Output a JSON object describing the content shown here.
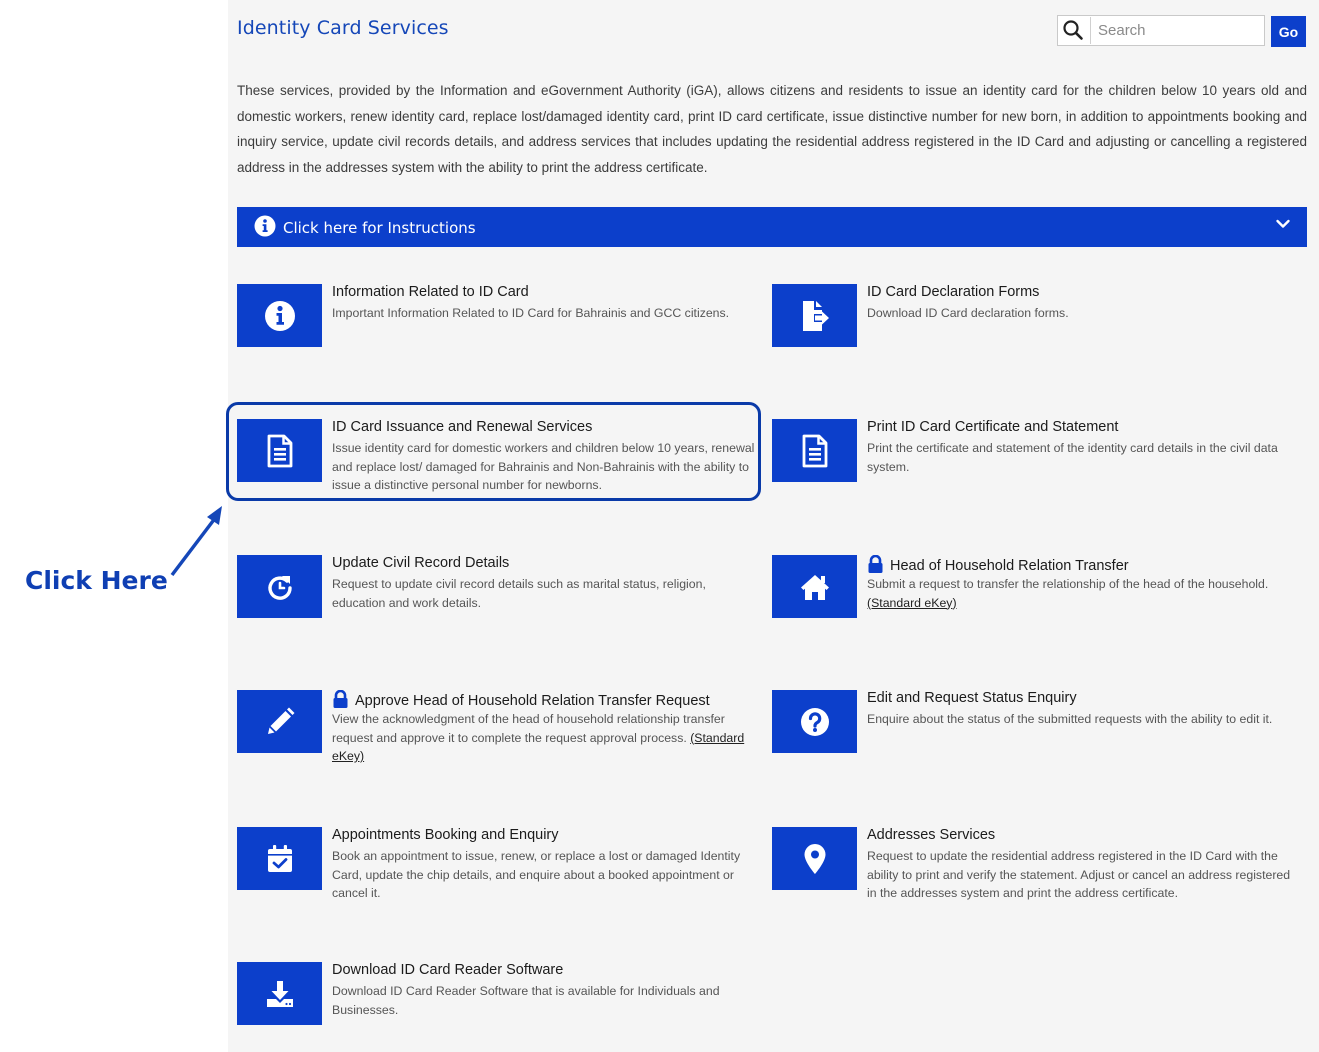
{
  "header": {
    "title": "Identity Card Services",
    "search_placeholder": "Search",
    "go_label": "Go"
  },
  "intro": "These services, provided by the Information and eGovernment Authority (iGA), allows citizens and residents to issue an identity card for the children below 10 years old and domestic workers, renew identity card, replace lost/damaged identity card, print ID card certificate, issue distinctive number for new born, in addition to appointments booking and inquiry service, update civil records details, and address services that includes updating the residential address registered in the ID Card and adjusting or cancelling a registered address in the addresses system with the ability to print the address certificate.",
  "instructions": {
    "label": "Click here for Instructions"
  },
  "services": [
    {
      "title": "Information Related to ID Card",
      "desc": "Important Information Related to ID Card for Bahrainis and GCC citizens.",
      "icon": "info-icon"
    },
    {
      "title": "ID Card Declaration Forms",
      "desc": "Download ID Card declaration forms.",
      "icon": "file-export-icon"
    },
    {
      "title": "ID Card Issuance and Renewal Services",
      "desc": "Issue identity card for domestic workers and children below 10 years, renewal and replace lost/ damaged for Bahrainis and Non-Bahrainis with the ability to issue a distinctive personal number for newborns.",
      "icon": "document-icon"
    },
    {
      "title": "Print ID Card Certificate and Statement",
      "desc": "Print the certificate and statement of the identity card details in the civil data system.",
      "icon": "document-icon"
    },
    {
      "title": "Update Civil Record Details",
      "desc": "Request to update civil record details such as marital status, religion, education and work details.",
      "icon": "refresh-icon"
    },
    {
      "title": "Head of Household Relation Transfer",
      "desc": "Submit a request to transfer the relationship of the head of the household.",
      "link": "(Standard eKey)",
      "icon": "home-icon",
      "locked": true
    },
    {
      "title": "Approve Head of Household Relation Transfer Request",
      "desc": "View the acknowledgment of the head of household relationship transfer request and approve it to complete the request approval process.",
      "link": "(Standard eKey)",
      "icon": "pencil-icon",
      "locked": true
    },
    {
      "title": "Edit and Request Status Enquiry",
      "desc": "Enquire about the status of the submitted requests with the ability to edit it.",
      "icon": "question-icon"
    },
    {
      "title": "Appointments Booking and Enquiry",
      "desc": "Book an appointment to issue, renew, or replace a lost or damaged Identity Card, update the chip details, and enquire about a booked appointment or cancel it.",
      "icon": "calendar-check-icon"
    },
    {
      "title": "Addresses Services",
      "desc": "Request to update the residential address registered in the ID Card with the ability to print and verify the statement. Adjust or cancel an address registered in the addresses system and print the address certificate.",
      "icon": "map-marker-icon"
    },
    {
      "title": "Download ID Card Reader Software",
      "desc": "Download ID Card Reader Software that is available for Individuals and Businesses.",
      "icon": "download-icon"
    }
  ],
  "annotation": {
    "label": "Click Here",
    "color": "#0f3fb3"
  },
  "colors": {
    "brand_blue": "#0c3fcb",
    "title_blue": "#1547b8",
    "panel_bg": "#f5f5f5"
  }
}
